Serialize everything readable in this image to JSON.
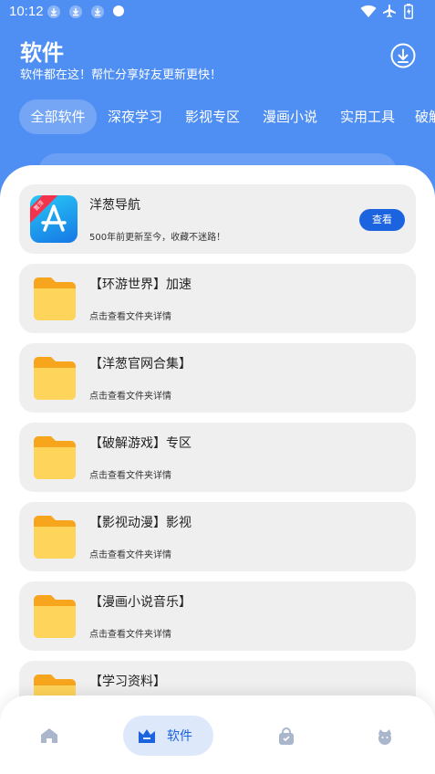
{
  "status_bar": {
    "time": "10:12",
    "left_icons": [
      "download-icon",
      "download-icon",
      "download-icon",
      "dot-icon"
    ],
    "right_icons": [
      "wifi-icon",
      "airplane-icon",
      "battery-icon"
    ]
  },
  "header": {
    "title": "软件",
    "subtitle": "软件都在这！帮忙分享好友更新更快！",
    "download_icon": "download-circle-icon"
  },
  "tabs": [
    {
      "label": "全部软件",
      "active": true
    },
    {
      "label": "深夜学习",
      "active": false
    },
    {
      "label": "影视专区",
      "active": false
    },
    {
      "label": "漫画小说",
      "active": false
    },
    {
      "label": "实用工具",
      "active": false
    },
    {
      "label": "破解",
      "active": false
    }
  ],
  "list": [
    {
      "title": "洋葱导航",
      "subtitle": "500年前更新至今，收藏不迷路！",
      "icon": "app-store-icon",
      "badge": "置顶",
      "action": "查看"
    },
    {
      "title": "【环游世界】加速",
      "subtitle": "点击查看文件夹详情",
      "icon": "folder-icon"
    },
    {
      "title": "【洋葱官网合集】",
      "subtitle": "点击查看文件夹详情",
      "icon": "folder-icon"
    },
    {
      "title": "【破解游戏】专区",
      "subtitle": "点击查看文件夹详情",
      "icon": "folder-icon"
    },
    {
      "title": "【影视动漫】影视",
      "subtitle": "点击查看文件夹详情",
      "icon": "folder-icon"
    },
    {
      "title": "【漫画小说音乐】",
      "subtitle": "点击查看文件夹详情",
      "icon": "folder-icon"
    },
    {
      "title": "【学习资料】",
      "subtitle": "",
      "icon": "folder-icon"
    }
  ],
  "bottom_nav": {
    "items": [
      {
        "icon": "home-icon",
        "label": "",
        "active": false
      },
      {
        "icon": "crown-icon",
        "label": "软件",
        "active": true
      },
      {
        "icon": "bag-icon",
        "label": "",
        "active": false
      },
      {
        "icon": "profile-icon",
        "label": "",
        "active": false
      }
    ]
  },
  "colors": {
    "brand_blue": "#4f8ef3",
    "button_blue": "#1c63e0",
    "card_bg": "#efefef",
    "folder_yellow": "#ffd45a"
  }
}
